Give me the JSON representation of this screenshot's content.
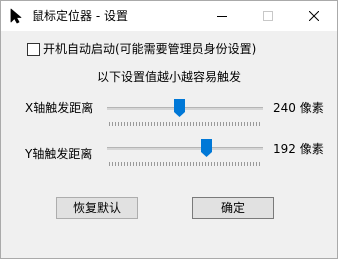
{
  "window": {
    "title": "鼠标定位器 - 设置"
  },
  "autostart": {
    "label": "开机自动启动(可能需要管理员身份设置)",
    "checked": false
  },
  "hint": "以下设置值越小越容易触发",
  "x_slider": {
    "label": "X轴触发距离",
    "value": "240 像素",
    "position_fraction": 0.46
  },
  "y_slider": {
    "label": "Y轴触发距离",
    "value": "192 像素",
    "position_fraction": 0.64
  },
  "buttons": {
    "reset": "恢复默认",
    "ok": "确定"
  },
  "colors": {
    "accent": "#0078d7",
    "titlebar": "#ffffff",
    "body": "#f0f0f0"
  },
  "icons": {
    "app": "mouse-cursor-icon",
    "minimize": "minimize-icon",
    "maximize": "maximize-icon",
    "close": "close-icon"
  }
}
